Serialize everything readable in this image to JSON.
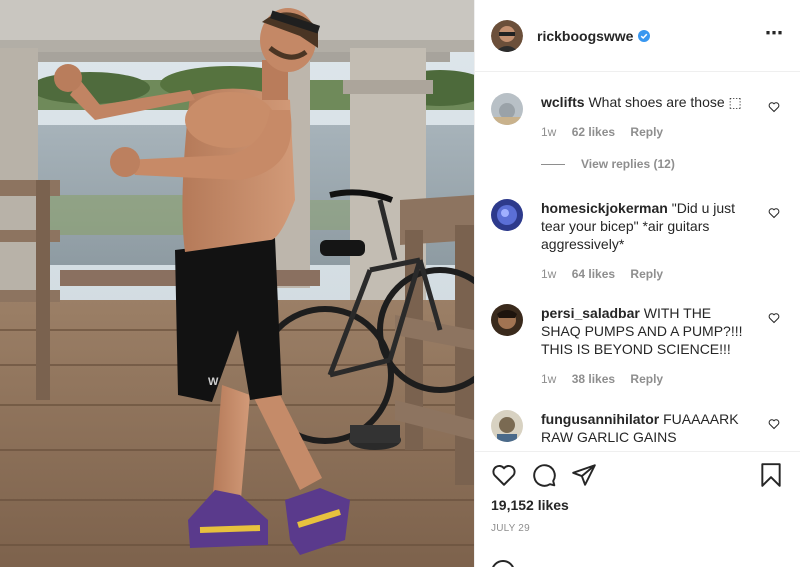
{
  "post": {
    "author": "rickboogswwe",
    "verified": true,
    "likes": "19,152 likes",
    "date": "July 29",
    "photo_alt": "Shirtless man flexing on a wooden pier next to a black bicycle"
  },
  "comments": [
    {
      "user": "wclifts",
      "text": "What shoes are those ⬚",
      "age": "1w",
      "likes": "62 likes",
      "reply_label": "Reply",
      "view_replies": "View replies (12)"
    },
    {
      "user": "homesickjokerman",
      "text": "\"Did u just tear your bicep\" *air guitars aggressively*",
      "age": "1w",
      "likes": "64 likes",
      "reply_label": "Reply"
    },
    {
      "user": "persi_saladbar",
      "text": "WITH THE SHAQ PUMPS AND A PUMP?!!! THIS IS BEYOND SCIENCE!!!",
      "age": "1w",
      "likes": "38 likes",
      "reply_label": "Reply"
    },
    {
      "user": "fungusannihilator",
      "text": "FUAAAARK RAW GARLIC GAINS"
    }
  ],
  "icons": {
    "more": "more-options-icon",
    "like": "heart-icon",
    "comment": "comment-icon",
    "share": "share-icon",
    "save": "bookmark-icon",
    "verified": "verified-badge-icon"
  },
  "colors": {
    "verified_blue": "#3897f0",
    "text": "#262626",
    "secondary_text": "#8e8e8e",
    "divider": "#efefef"
  }
}
